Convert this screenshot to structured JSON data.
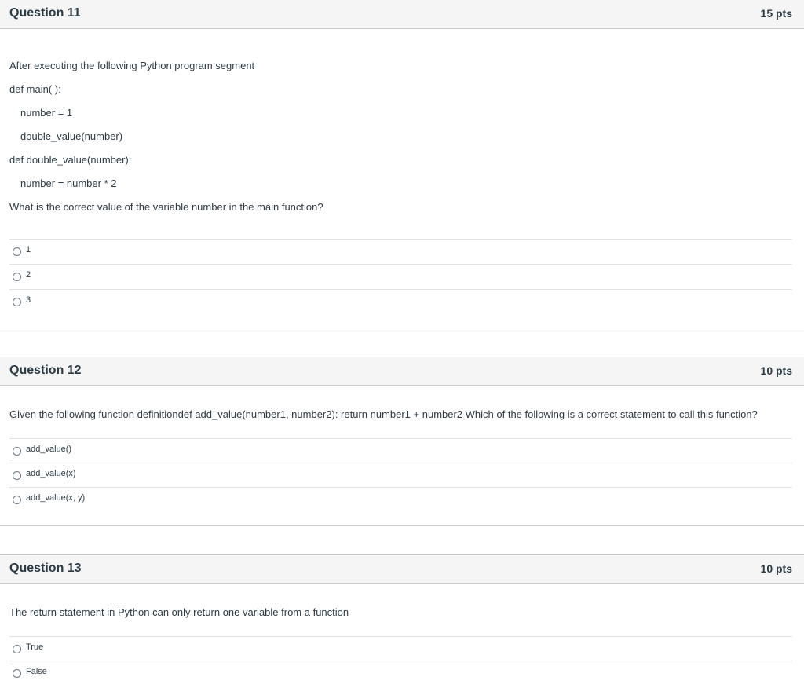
{
  "questions": [
    {
      "title": "Question 11",
      "points": "15 pts",
      "lines": [
        "After executing the following Python program segment",
        "def main( ):",
        "number = 1",
        "double_value(number)",
        "def double_value(number):",
        "number = number * 2",
        "What is the correct value of the variable number in the main function?"
      ],
      "answers": [
        "1",
        "2",
        "3"
      ]
    },
    {
      "title": "Question 12",
      "points": "10 pts",
      "lines": [
        "Given the following function definitiondef add_value(number1, number2): return number1 + number2 Which of the following is a correct statement to call this function?"
      ],
      "answers": [
        "add_value()",
        "add_value(x)",
        "add_value(x, y)"
      ]
    },
    {
      "title": "Question 13",
      "points": "10 pts",
      "lines": [
        "The return statement in Python can only return one variable from a function"
      ],
      "answers": [
        "True",
        "False"
      ]
    }
  ]
}
